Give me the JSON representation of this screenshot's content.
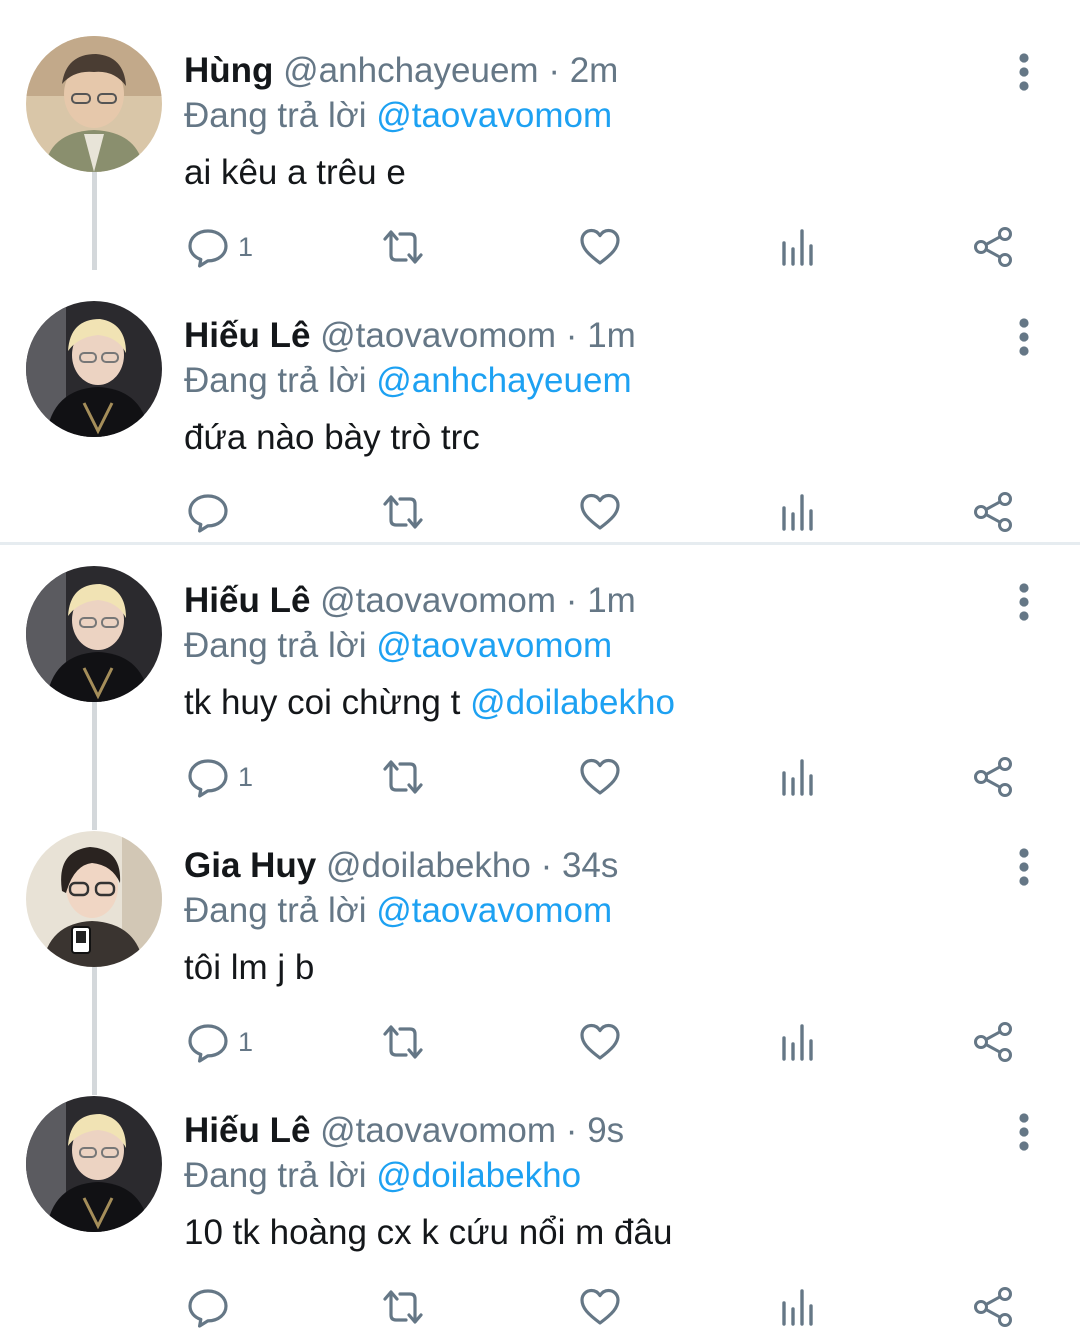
{
  "colors": {
    "text": "#14171a",
    "secondary": "#657786",
    "mention": "#1da1f2",
    "thread_line": "#d4d8db",
    "separator": "#e6ecf0"
  },
  "icons": {
    "reply": "reply-icon",
    "retweet": "retweet-icon",
    "like": "heart-icon",
    "analytics": "analytics-icon",
    "share": "share-icon",
    "more": "more-vertical-icon"
  },
  "tweets": [
    {
      "name": "Hùng",
      "handle": "@anhchayeuem",
      "dot": "·",
      "time": "2m",
      "reply_prefix": "Đang trả lời",
      "reply_to": "@taovavomom",
      "text": "ai kêu a trêu e",
      "text_mention": "",
      "reply_count": "1"
    },
    {
      "name": "Hiếu Lê",
      "handle": "@taovavomom",
      "dot": "·",
      "time": "1m",
      "reply_prefix": "Đang trả lời",
      "reply_to": "@anhchayeuem",
      "text": "đứa nào bày trò trc",
      "text_mention": "",
      "reply_count": ""
    },
    {
      "name": "Hiếu Lê",
      "handle": "@taovavomom",
      "dot": "·",
      "time": "1m",
      "reply_prefix": "Đang trả lời",
      "reply_to": "@taovavomom",
      "text": "tk huy coi chừng t ",
      "text_mention": "@doilabekho",
      "reply_count": "1"
    },
    {
      "name": "Gia Huy",
      "handle": "@doilabekho",
      "dot": "·",
      "time": "34s",
      "reply_prefix": "Đang trả lời",
      "reply_to": "@taovavomom",
      "text": "tôi lm j b",
      "text_mention": "",
      "reply_count": "1"
    },
    {
      "name": "Hiếu Lê",
      "handle": "@taovavomom",
      "dot": "·",
      "time": "9s",
      "reply_prefix": "Đang trả lời",
      "reply_to": "@doilabekho",
      "text": "10 tk hoàng cx k cứu nổi m đâu",
      "text_mention": "",
      "reply_count": ""
    }
  ]
}
